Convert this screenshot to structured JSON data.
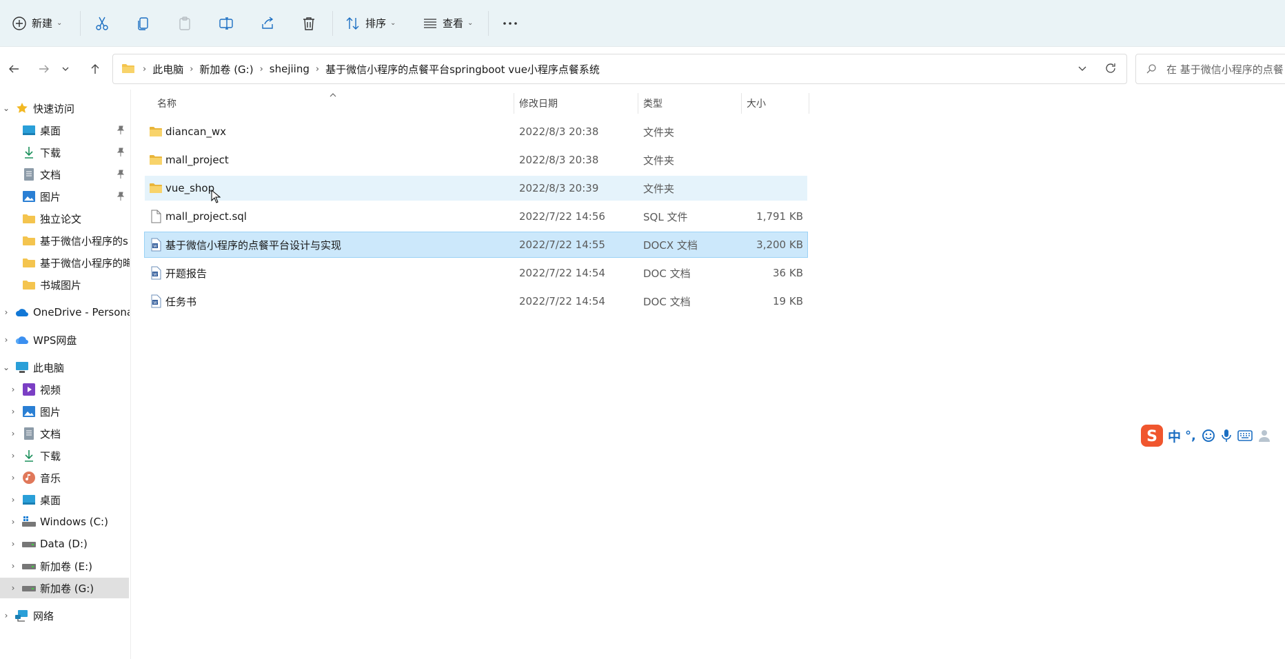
{
  "toolbar": {
    "new_label": "新建",
    "sort_label": "排序",
    "view_label": "查看"
  },
  "breadcrumb": [
    "此电脑",
    "新加卷 (G:)",
    "shejiing",
    "基于微信小程序的点餐平台springboot vue小程序点餐系统"
  ],
  "search": {
    "placeholder": "在 基于微信小程序的点餐"
  },
  "sidebar": {
    "quick_access": "快速访问",
    "quick_items": [
      "桌面",
      "下载",
      "文档",
      "图片",
      "独立论文",
      "基于微信小程序的s",
      "基于微信小程序的晦",
      "书城图片"
    ],
    "onedrive": "OneDrive - Persona",
    "wps": "WPS网盘",
    "this_pc": "此电脑",
    "pc_items": [
      "视频",
      "图片",
      "文档",
      "下载",
      "音乐",
      "桌面",
      "Windows (C:)",
      "Data (D:)",
      "新加卷 (E:)",
      "新加卷 (G:)"
    ],
    "network": "网络"
  },
  "columns": {
    "name": "名称",
    "date": "修改日期",
    "type": "类型",
    "size": "大小"
  },
  "files": [
    {
      "name": "diancan_wx",
      "date": "2022/8/3 20:38",
      "type": "文件夹",
      "size": "",
      "icon": "folder-icon"
    },
    {
      "name": "mall_project",
      "date": "2022/8/3 20:38",
      "type": "文件夹",
      "size": "",
      "icon": "folder-icon"
    },
    {
      "name": "vue_shop",
      "date": "2022/8/3 20:39",
      "type": "文件夹",
      "size": "",
      "icon": "folder-icon"
    },
    {
      "name": "mall_project.sql",
      "date": "2022/7/22 14:56",
      "type": "SQL 文件",
      "size": "1,791 KB",
      "icon": "file-icon"
    },
    {
      "name": "基于微信小程序的点餐平台设计与实现",
      "date": "2022/7/22 14:55",
      "type": "DOCX 文档",
      "size": "3,200 KB",
      "icon": "word-doc-icon"
    },
    {
      "name": "开题报告",
      "date": "2022/7/22 14:54",
      "type": "DOC 文档",
      "size": "36 KB",
      "icon": "word-doc-icon"
    },
    {
      "name": "任务书",
      "date": "2022/7/22 14:54",
      "type": "DOC 文档",
      "size": "19 KB",
      "icon": "word-doc-icon"
    }
  ],
  "ime": {
    "mode": "中",
    "punct": "°,"
  },
  "colors": {
    "toolbar_bg": "#eaf3f6",
    "selected_row": "#cce8fb",
    "hover_row": "#e5f3fb",
    "folder": "#f4c44e",
    "accent": "#1b6ec2"
  }
}
